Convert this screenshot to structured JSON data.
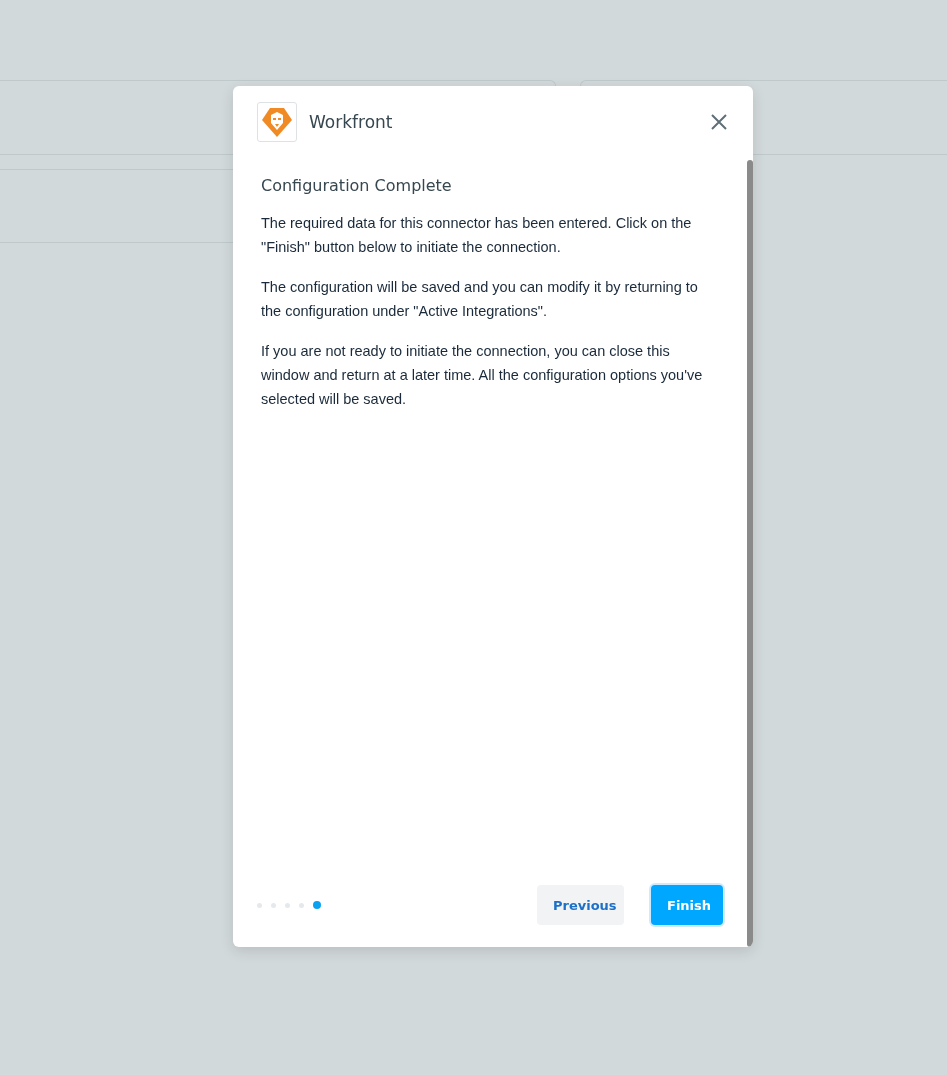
{
  "dialog": {
    "title": "Workfront",
    "heading": "Configuration Complete",
    "paragraphs": [
      "The required data for this connector has been entered. Click on the \"Finish\" button below to initiate the connection.",
      "The configuration will be saved and you can modify it by returning to the configuration under \"Active Integrations\".",
      "If you are not ready to initiate the connection, you can close this window and return at a later time. All the configuration options you've selected will be saved."
    ],
    "steps": [
      {
        "selected": false
      },
      {
        "selected": false
      },
      {
        "selected": false
      },
      {
        "selected": false
      },
      {
        "selected": true
      }
    ],
    "buttons": [
      {
        "label": "Previous",
        "kind": "secondary"
      },
      {
        "label": "Finish",
        "kind": "primary"
      }
    ]
  }
}
